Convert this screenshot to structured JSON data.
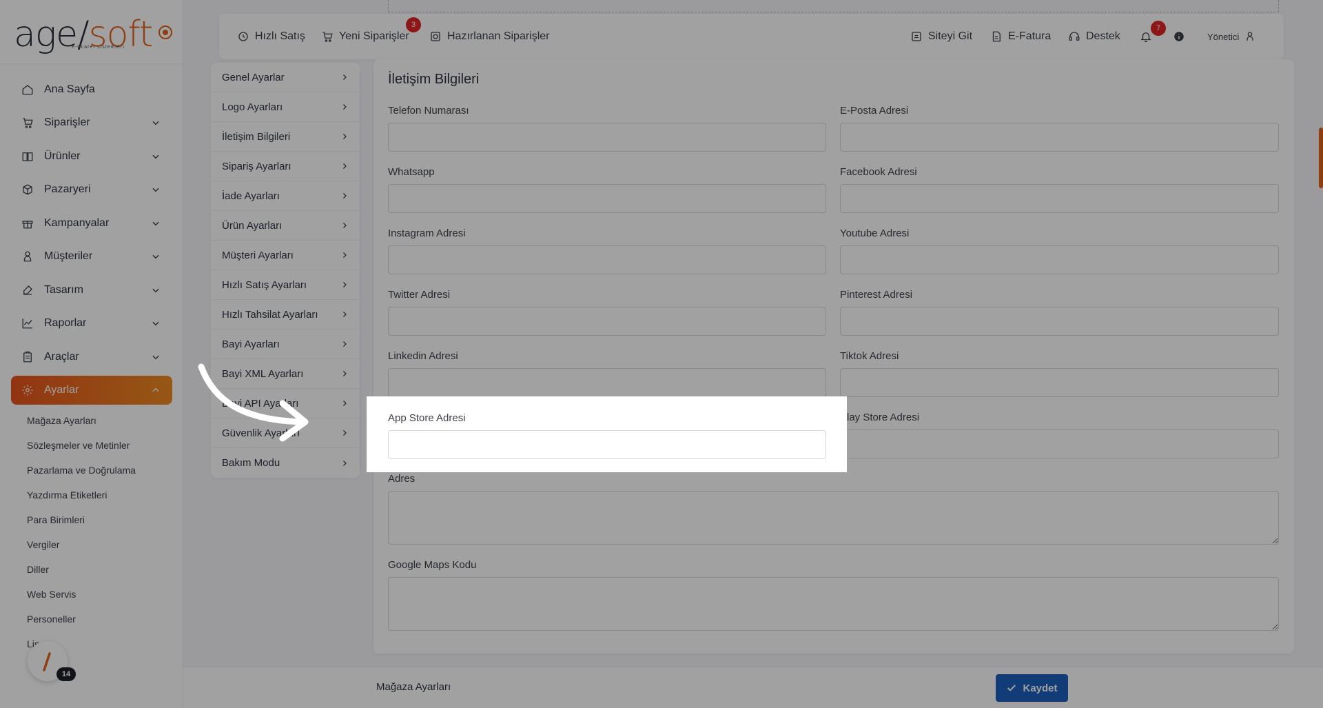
{
  "brand": {
    "logo_main": "age/",
    "logo_soft": "soft",
    "logo_sub": "e-ticaret sistemleri"
  },
  "sidebar": {
    "items": [
      {
        "label": "Ana Sayfa",
        "icon": "home-icon",
        "expandable": false
      },
      {
        "label": "Siparişler",
        "icon": "cart-icon",
        "expandable": true
      },
      {
        "label": "Ürünler",
        "icon": "box-icon",
        "expandable": true
      },
      {
        "label": "Pazaryeri",
        "icon": "cube-icon",
        "expandable": true
      },
      {
        "label": "Kampanyalar",
        "icon": "gift-icon",
        "expandable": true
      },
      {
        "label": "Müşteriler",
        "icon": "user-icon",
        "expandable": true
      },
      {
        "label": "Tasarım",
        "icon": "brush-icon",
        "expandable": true
      },
      {
        "label": "Raporlar",
        "icon": "chart-icon",
        "expandable": true
      },
      {
        "label": "Araçlar",
        "icon": "clipboard-icon",
        "expandable": true
      },
      {
        "label": "Ayarlar",
        "icon": "gear-icon",
        "expandable": true,
        "active": true
      }
    ],
    "submenu": [
      "Mağaza Ayarları",
      "Sözleşmeler ve Metinler",
      "Pazarlama ve Doğrulama",
      "Yazdırma Etiketleri",
      "Para Birimleri",
      "Vergiler",
      "Diller",
      "Web Servis",
      "Personeller",
      "Lis"
    ],
    "fab_badge": "14"
  },
  "topbar": {
    "quick_sale": "Hızlı Satış",
    "new_orders": "Yeni Siparişler",
    "new_orders_badge": "3",
    "prepared_orders": "Hazırlanan Siparişler",
    "go_site": "Siteyi Git",
    "e_invoice": "E-Fatura",
    "support": "Destek",
    "notifications_badge": "7",
    "user": "Yönetici"
  },
  "settings_menu": [
    "Genel Ayarlar",
    "Logo Ayarları",
    "İletişim Bilgileri",
    "Sipariş Ayarları",
    "İade Ayarları",
    "Ürün Ayarları",
    "Müşteri Ayarları",
    "Hızlı Satış Ayarları",
    "Hızlı Tahsilat Ayarları",
    "Bayi Ayarları",
    "Bayi XML Ayarları",
    "Bayi API Ayarları",
    "Güvenlik Ayarları",
    "Bakım Modu"
  ],
  "form": {
    "title": "İletişim Bilgileri",
    "phone_label": "Telefon Numarası",
    "email_label": "E-Posta Adresi",
    "whatsapp_label": "Whatsapp",
    "facebook_label": "Facebook Adresi",
    "instagram_label": "Instagram Adresi",
    "youtube_label": "Youtube Adresi",
    "twitter_label": "Twitter Adresi",
    "pinterest_label": "Pinterest Adresi",
    "linkedin_label": "Linkedin Adresi",
    "tiktok_label": "Tiktok Adresi",
    "appstore_label": "App Store Adresi",
    "playstore_label": "Play Store Adresi",
    "address_label": "Adres",
    "maps_label": "Google Maps Kodu"
  },
  "bottom": {
    "title": "Mağaza Ayarları",
    "save": "Kaydet"
  },
  "colors": {
    "accent": "#e2621d",
    "primary": "#1b5fbf",
    "badge": "#e02424"
  }
}
